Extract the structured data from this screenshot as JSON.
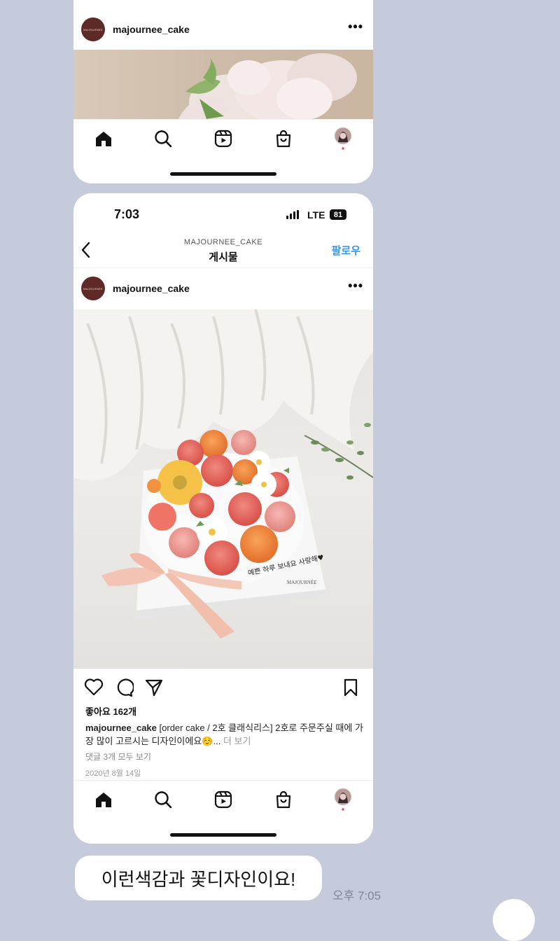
{
  "post_top": {
    "username": "majournee_cake",
    "avatar_text": "MAJOURNEE"
  },
  "post_main": {
    "status_time": "7:03",
    "network": "LTE",
    "battery": "81",
    "account_header": "MAJOURNEE_CAKE",
    "page_title": "게시물",
    "follow_label": "팔로우",
    "username": "majournee_cake",
    "avatar_text": "MAJOURNEE",
    "likes": "좋아요 162개",
    "caption_user": "majournee_cake",
    "caption_text": " [order cake / 2호 클래식리스] 2호로 주문주실 때에 가장 많이 고르시는 디자인이에요☺️...",
    "caption_more": " 더 보기",
    "comments_link": "댓글 3개 모두 보기",
    "date": "2020년 8월 14일",
    "cake_tag_text": "MAJOURNÉE",
    "cake_message": "예쁜 하루 보내요 사랑해♥"
  },
  "chat": {
    "message": "이런색감과 꽃디자인이요!",
    "time": "오후 7:05"
  },
  "icons": [
    "home-icon",
    "search-icon",
    "reels-icon",
    "shop-icon",
    "profile-avatar",
    "heart-icon",
    "comment-icon",
    "share-icon",
    "bookmark-icon",
    "back-chevron-icon",
    "more-icon"
  ]
}
